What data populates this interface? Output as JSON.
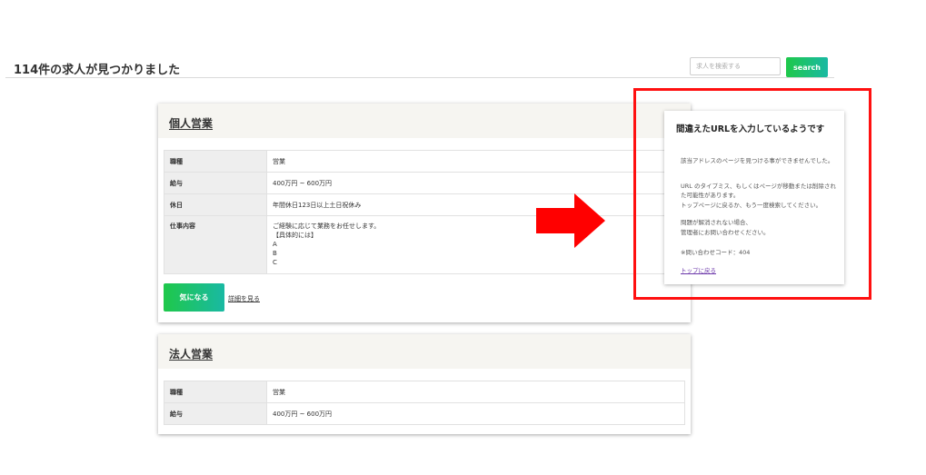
{
  "header": {
    "results_title": "114件の求人が見つかりました",
    "search_placeholder": "求人を検索する",
    "search_label": "search"
  },
  "jobs": [
    {
      "title": "個人営業",
      "rows": [
        {
          "label": "職種",
          "value": "営業"
        },
        {
          "label": "給与",
          "value": "400万円 ~ 600万円"
        },
        {
          "label": "休日",
          "value": "年間休日123日以上土日祝休み"
        },
        {
          "label": "仕事内容",
          "lines": [
            "ご経験に応じて業務をお任せします。",
            "【具体的には】",
            "A",
            "B",
            "C"
          ]
        }
      ],
      "fav_label": "気になる",
      "detail_label": "詳細を見る"
    },
    {
      "title": "法人営業",
      "rows": [
        {
          "label": "職種",
          "value": "営業"
        },
        {
          "label": "給与",
          "value": "400万円 ~ 600万円"
        }
      ]
    }
  ],
  "error_page": {
    "title": "間違えたURLを入力しているようです",
    "message1": "該当アドレスのページを見つける事ができませんでした。",
    "message2_line1": "URL のタイプミス、もしくはページが移動または削除された可能性があります。",
    "message2_line2": "トップページに戻るか、もう一度検索してください。",
    "message3_line1": "問題が解消されない場合、",
    "message3_line2": "管理者にお問い合わせください。",
    "code": "※問い合わせコード：404",
    "back_link": "トップに戻る"
  },
  "annotation_colors": {
    "frame": "#ff1010",
    "arrow": "#ff0000"
  },
  "icons": [
    "right-arrow-icon"
  ]
}
